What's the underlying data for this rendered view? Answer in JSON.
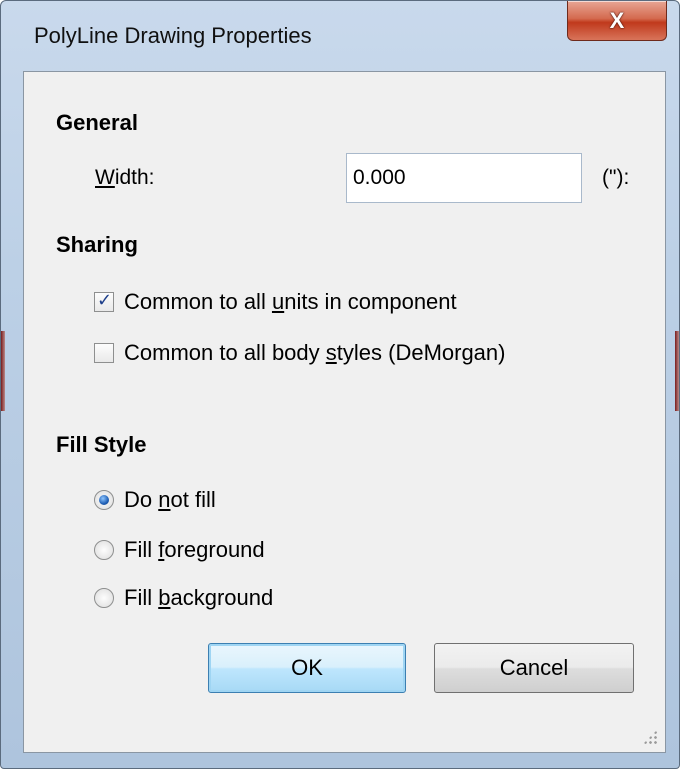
{
  "window": {
    "title": "PolyLine Drawing Properties",
    "close_icon": "close-icon",
    "close_glyph": "X"
  },
  "general": {
    "heading": "General",
    "width_label_underlined": "W",
    "width_label_rest": "idth:",
    "width_value": "0.000",
    "unit_label": "(\"):"
  },
  "sharing": {
    "heading": "Sharing",
    "units_option": {
      "before": "Common to all ",
      "underlined": "u",
      "after": "nits in component",
      "checked": true
    },
    "styles_option": {
      "before": "Common to all body ",
      "underlined": "s",
      "after": "tyles (DeMorgan)",
      "checked": false
    }
  },
  "fill_style": {
    "heading": "Fill Style",
    "options": [
      {
        "before": "Do ",
        "underlined": "n",
        "after": "ot fill",
        "selected": true
      },
      {
        "before": "Fill ",
        "underlined": "f",
        "after": "oreground",
        "selected": false
      },
      {
        "before": "Fill ",
        "underlined": "b",
        "after": "ackground",
        "selected": false
      }
    ]
  },
  "buttons": {
    "ok_label": "OK",
    "cancel_label": "Cancel"
  },
  "colors": {
    "default_button_border": "#3c7fb1",
    "check_mark": "#1e3f8a",
    "close_button": "#c0391c"
  }
}
